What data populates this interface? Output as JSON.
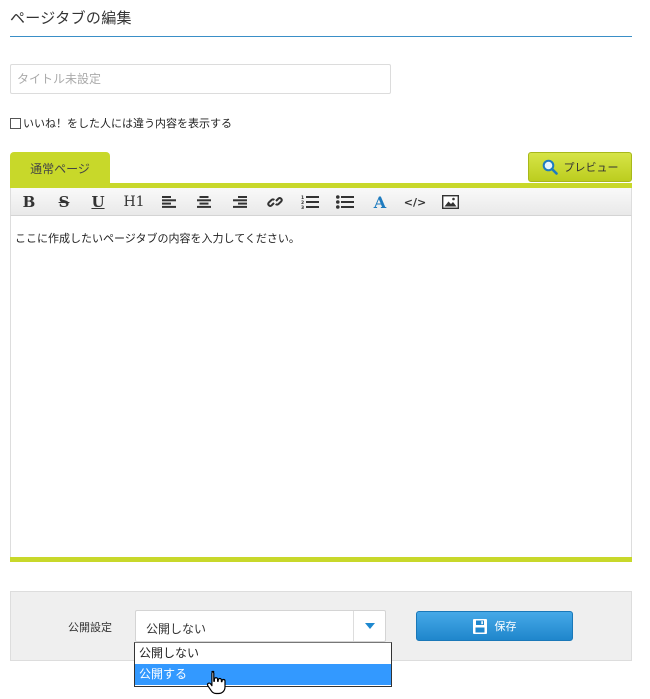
{
  "header": {
    "title": "ページタブの編集"
  },
  "title_input": {
    "placeholder": "タイトル未設定",
    "value": ""
  },
  "like_option": {
    "label": "いいね！をした人には違う内容を表示する",
    "checked": false
  },
  "tabs": [
    {
      "label": "通常ページ",
      "active": true
    }
  ],
  "preview": {
    "label": "プレビュー",
    "icon": "search-icon"
  },
  "toolbar": {
    "buttons": [
      {
        "name": "bold",
        "glyph": "B"
      },
      {
        "name": "strikethrough",
        "glyph": "S"
      },
      {
        "name": "underline",
        "glyph": "U"
      },
      {
        "name": "heading",
        "glyph": "H1"
      },
      {
        "name": "align-left",
        "glyph": ""
      },
      {
        "name": "align-center",
        "glyph": ""
      },
      {
        "name": "align-right",
        "glyph": ""
      },
      {
        "name": "link",
        "glyph": ""
      },
      {
        "name": "ordered-list",
        "glyph": ""
      },
      {
        "name": "unordered-list",
        "glyph": ""
      },
      {
        "name": "text-color",
        "glyph": "A"
      },
      {
        "name": "source-code",
        "glyph": "</>"
      },
      {
        "name": "image",
        "glyph": ""
      }
    ]
  },
  "editor": {
    "content": "ここに作成したいページタブの内容を入力してください。"
  },
  "publish": {
    "label": "公開設定",
    "selected": "公開しない",
    "options": [
      "公開しない",
      "公開する"
    ],
    "highlighted_index": 1
  },
  "save": {
    "label": "保存",
    "icon": "floppy-disk-icon"
  },
  "colors": {
    "accent_green": "#c8d82a",
    "accent_blue": "#2a8fd6",
    "rule_blue": "#3a8fc7"
  }
}
